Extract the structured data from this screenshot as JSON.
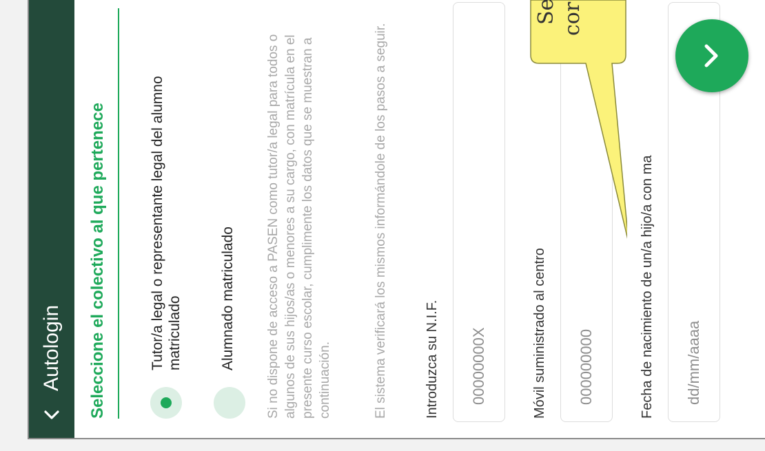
{
  "header": {
    "title": "Autologin",
    "back_icon": "chevron-down-icon"
  },
  "section": {
    "title": "Seleccione el colectivo al que pertenece"
  },
  "options": [
    {
      "label": "Tutor/a legal o representante legal del alumno matriculado",
      "selected": true
    },
    {
      "label": "Alumnado matriculado",
      "selected": false
    }
  ],
  "info": {
    "p1": "Si no dispone de acceso a PASEN como tutor/a legal para todos o algunos de sus hijos/as o menores a su cargo, con matrícula en el presente curso escolar, cumplimente los datos que se muestran a continuación.",
    "p2": "El sistema verificará los mismos informándole de los pasos a seguir."
  },
  "fields": {
    "nif": {
      "label": "Introduzca su N.I.F.",
      "placeholder": "00000000X"
    },
    "movil": {
      "label": "Móvil suministrado al centro",
      "placeholder": "000000000"
    },
    "fecha": {
      "label": "Fecha de nacimiento de un/a hijo/a con ma",
      "placeholder": "dd/mm/aaaa"
    }
  },
  "callout": {
    "line1": "Se",
    "line2": "cor"
  },
  "next_button": {
    "icon": "chevron-right-icon"
  },
  "colors": {
    "header": "#234a3a",
    "accent": "#1ea95a",
    "callout": "#fbf27a"
  }
}
